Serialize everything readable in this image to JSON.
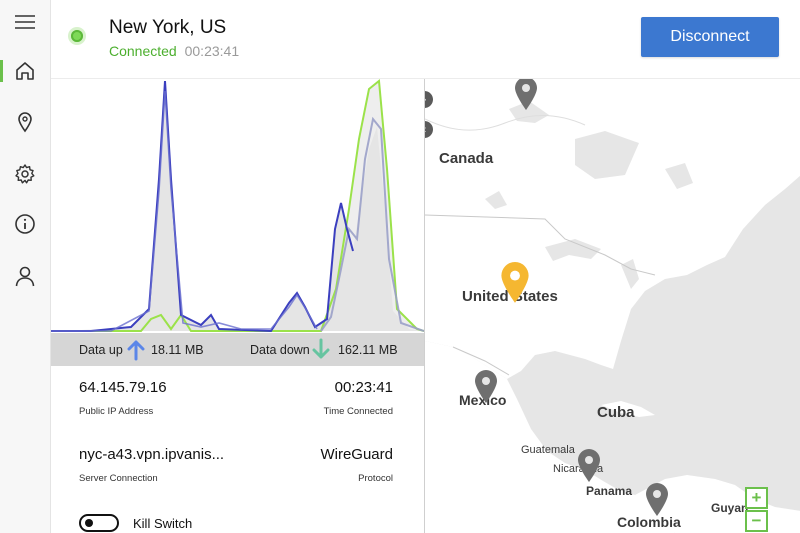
{
  "header": {
    "location": "New York, US",
    "status": "Connected",
    "timer": "00:23:41",
    "disconnect_label": "Disconnect"
  },
  "sidebar": {
    "items": [
      {
        "icon": "hamburger-menu-icon"
      },
      {
        "icon": "home-icon",
        "active": true
      },
      {
        "icon": "location-pin-icon"
      },
      {
        "icon": "gear-icon"
      },
      {
        "icon": "info-icon"
      },
      {
        "icon": "user-icon"
      }
    ]
  },
  "stats": {
    "data_up_label": "Data up",
    "data_up_value": "18.11 MB",
    "data_down_label": "Data down",
    "data_down_value": "162.11 MB"
  },
  "info": {
    "ip_value": "64.145.79.16",
    "ip_label": "Public IP Address",
    "time_value": "00:23:41",
    "time_label": "Time Connected",
    "server_value": "nyc-a43.vpn.ipvanis...",
    "server_label": "Server Connection",
    "protocol_value": "WireGuard",
    "protocol_label": "Protocol"
  },
  "kill_switch": {
    "label": "Kill Switch",
    "enabled": false
  },
  "map": {
    "labels": {
      "canada": "Canada",
      "united_states": "United States",
      "mexico": "Mexico",
      "cuba": "Cuba",
      "guatemala": "Guatemala",
      "nicaragua": "Nicaragua",
      "panama": "Panama",
      "colombia": "Colombia",
      "guyana": "Guyan"
    },
    "zoom_in": "+",
    "zoom_out": "−"
  },
  "colors": {
    "accent_green": "#6bc04b",
    "button_blue": "#3c78d0",
    "upload_line": "#3b3fbf",
    "download_line": "#9be24a",
    "pin_active": "#f5b731",
    "pin_inactive": "#6f6f6f"
  }
}
